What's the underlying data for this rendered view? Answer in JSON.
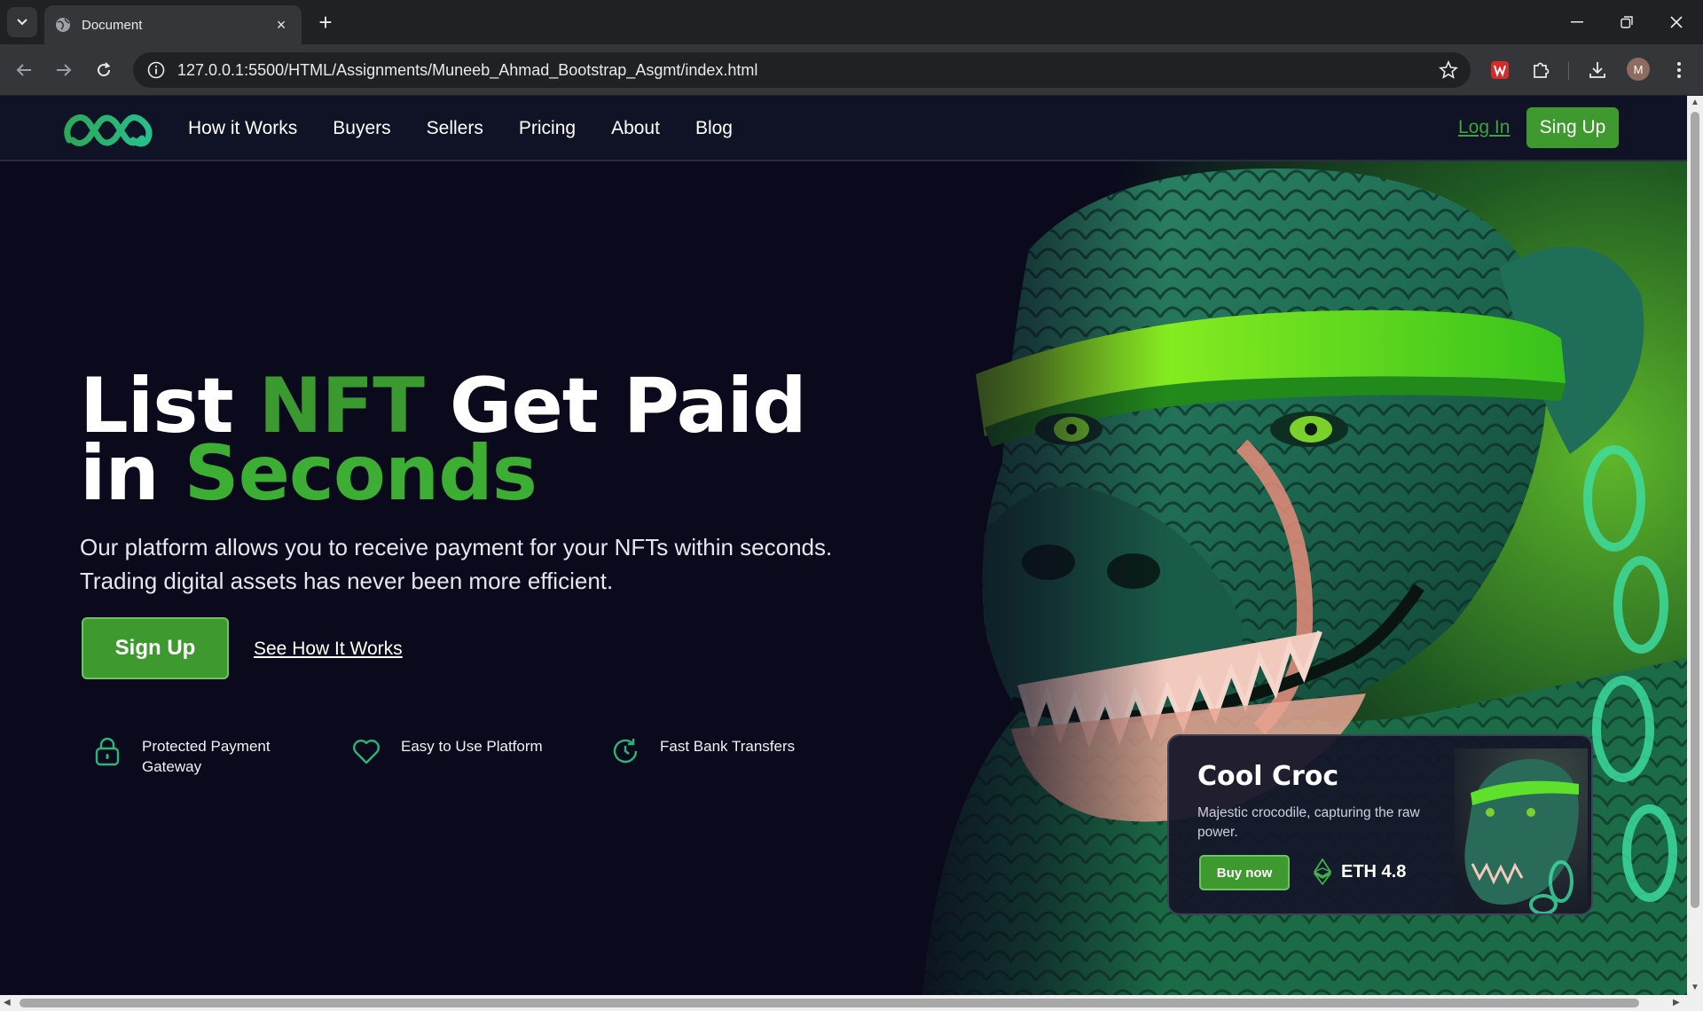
{
  "browser": {
    "tab_title": "Document",
    "url": "127.0.0.1:5500/HTML/Assignments/Muneeb_Ahmad_Bootstrap_Asgmt/index.html",
    "profile_initial": "M",
    "new_tab_symbol": "+",
    "close_tab_symbol": "×"
  },
  "nav": {
    "links": [
      "How it Works",
      "Buyers",
      "Sellers",
      "Pricing",
      "About",
      "Blog"
    ],
    "login_label": "Log In",
    "signup_label": "Sing Up"
  },
  "hero": {
    "headline_w1": "List",
    "headline_w2": "NFT",
    "headline_w3": "Get Paid",
    "headline_w4": "in",
    "headline_w5": "Seconds",
    "subtext": "Our platform allows you to receive payment for your NFTs within seconds. Trading digital assets has never been more efficient.",
    "signup_label": "Sign Up",
    "see_how_label": "See How It Works"
  },
  "features": [
    {
      "label_line1": "Protected Payment",
      "label_line2": "Gateway",
      "icon": "lock-icon"
    },
    {
      "label_line1": "Easy to Use Platform",
      "label_line2": "",
      "icon": "heart-icon"
    },
    {
      "label_line1": "Fast Bank Transfers",
      "label_line2": "",
      "icon": "clock-refresh-icon"
    }
  ],
  "card": {
    "title": "Cool Croc",
    "description": "Majestic crocodile, capturing the raw power.",
    "buy_label": "Buy now",
    "price": "ETH 4.8"
  },
  "colors": {
    "brand_green": "#3e9a2e",
    "page_bg": "#0a0a1c",
    "nav_bg": "#101226"
  }
}
